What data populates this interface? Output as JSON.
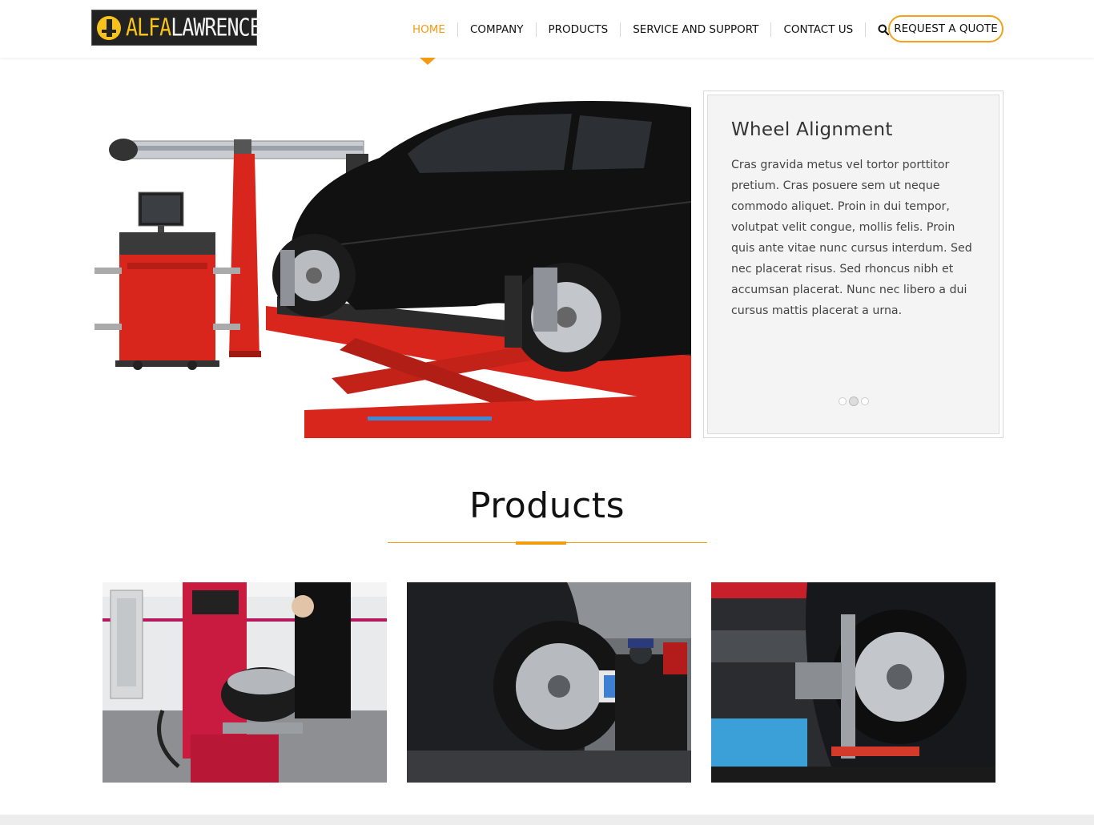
{
  "header": {
    "logo": {
      "text_a": "ALFA",
      "text_b": "LAWRENCE"
    },
    "nav": [
      {
        "label": "HOME",
        "active": true
      },
      {
        "label": "COMPANY",
        "active": false
      },
      {
        "label": "PRODUCTS",
        "active": false
      },
      {
        "label": "SERVICE AND SUPPORT",
        "active": false
      },
      {
        "label": "CONTACT US",
        "active": false
      }
    ],
    "search_icon": "search-icon",
    "quote_button": "REQUEST A QUOTE"
  },
  "hero": {
    "title": "Wheel Alignment",
    "text": "Cras gravida metus vel tortor porttitor pretium. Cras posuere sem ut neque commodo aliquet. Proin in dui tempor, volutpat velit congue, mollis felis. Proin quis ante vitae nunc cursus interdum. Sed nec placerat risus. Sed rhoncus nibh et accumsan placerat. Nunc nec libero a dui cursus mattis placerat a urna.",
    "slide_count": 3,
    "active_slide": 2
  },
  "products": {
    "title": "Products"
  },
  "colors": {
    "accent": "#f59b12",
    "logo_yellow": "#f6c21b",
    "lift_red": "#d9261c"
  }
}
